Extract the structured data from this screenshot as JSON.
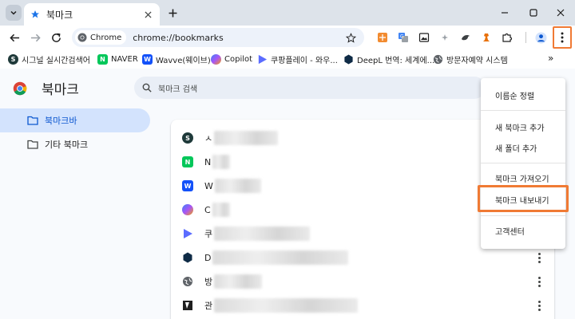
{
  "window": {
    "tab_title": "북마크",
    "colors": {
      "accent": "#f07a34",
      "tab_strip": "#dde3ea",
      "active_nav": "#d3e3fd"
    }
  },
  "toolbar": {
    "chip_label": "Chrome",
    "url": "chrome://bookmarks",
    "extensions": [
      "gift-icon",
      "translate-icon",
      "image-icon",
      "spark-icon",
      "bird-icon",
      "chess-icon",
      "puzzle-icon"
    ]
  },
  "bookmark_bar": {
    "items": [
      {
        "label": "시그널 실시간검색어",
        "icon": "signal-icon",
        "color": "#1f3a3a"
      },
      {
        "label": "NAVER",
        "icon": "naver-icon",
        "color": "#03c75a"
      },
      {
        "label": "Wavve(웨이브)",
        "icon": "wavve-icon",
        "color": "#1351f9"
      },
      {
        "label": "Copilot",
        "icon": "copilot-icon",
        "color": "#8a5cf6"
      },
      {
        "label": "쿠팡플레이 - 와우...",
        "icon": "coupang-play-icon",
        "color": "#5b6cff"
      },
      {
        "label": "DeepL 번역: 세계에...",
        "icon": "deepl-icon",
        "color": "#0f2b46"
      },
      {
        "label": "방문자예약 시스템",
        "icon": "globe-icon",
        "color": "#5f6368"
      }
    ],
    "more": "»"
  },
  "page": {
    "title": "북마크",
    "search_placeholder": "북마크 검색"
  },
  "sidebar": {
    "items": [
      {
        "label": "북마크바",
        "active": true
      },
      {
        "label": "기타 북마크",
        "active": false
      }
    ]
  },
  "bookmarks": {
    "rows": [
      {
        "letter": "ㅅ",
        "icon": "signal-icon",
        "color": "#1f3a3a"
      },
      {
        "letter": "N",
        "icon": "naver-icon",
        "color": "#03c75a"
      },
      {
        "letter": "W",
        "icon": "wavve-icon",
        "color": "#1351f9"
      },
      {
        "letter": "C",
        "icon": "copilot-icon",
        "color": "#8a5cf6"
      },
      {
        "letter": "쿠",
        "icon": "coupang-play-icon",
        "color": "#5b6cff"
      },
      {
        "letter": "D",
        "icon": "deepl-icon",
        "color": "#0f2b46"
      },
      {
        "letter": "방",
        "icon": "globe-icon",
        "color": "#5f6368"
      },
      {
        "letter": "관",
        "icon": "bookmark-site-icon",
        "color": "#1f1f1f"
      }
    ]
  },
  "menu": {
    "items": [
      {
        "label": "이름순 정렬"
      },
      {
        "label": "새 북마크 추가"
      },
      {
        "label": "새 폴더 추가"
      },
      {
        "label": "북마크 가져오기"
      },
      {
        "label": "북마크 내보내기"
      },
      {
        "label": "고객센터"
      }
    ]
  }
}
